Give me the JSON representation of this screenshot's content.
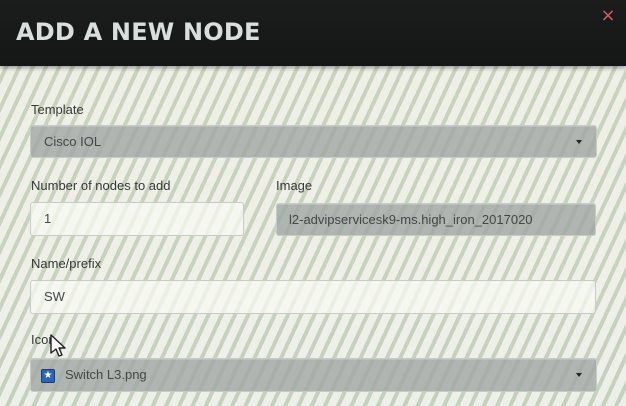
{
  "modal": {
    "title": "ADD A NEW NODE",
    "close_icon": "close-icon",
    "close_text": "×"
  },
  "form": {
    "template": {
      "label": "Template",
      "value": "Cisco IOL",
      "control": "dropdown",
      "indicator_icon": "caret-down-icon"
    },
    "node_count": {
      "label": "Number of nodes to add",
      "value": "1"
    },
    "image": {
      "label": "Image",
      "value": "l2-advipservicesk9-ms.high_iron_2017020",
      "control": "dropdown"
    },
    "name_prefix": {
      "label": "Name/prefix",
      "value": "SW"
    },
    "icon": {
      "label": "Icon",
      "value": "Switch L3.png",
      "control": "dropdown",
      "option_icon": "star-icon",
      "option_icon_text": "★",
      "indicator_icon": "caret-down-icon"
    }
  },
  "colors": {
    "header": "#181a1a",
    "title": "#d9dfdd",
    "close": "#d45f59",
    "selected_select": "#9fa4a2",
    "icon_blue": "#2d62b7"
  },
  "overlay": {
    "cursor_icon": "mouse-pointer-icon"
  }
}
